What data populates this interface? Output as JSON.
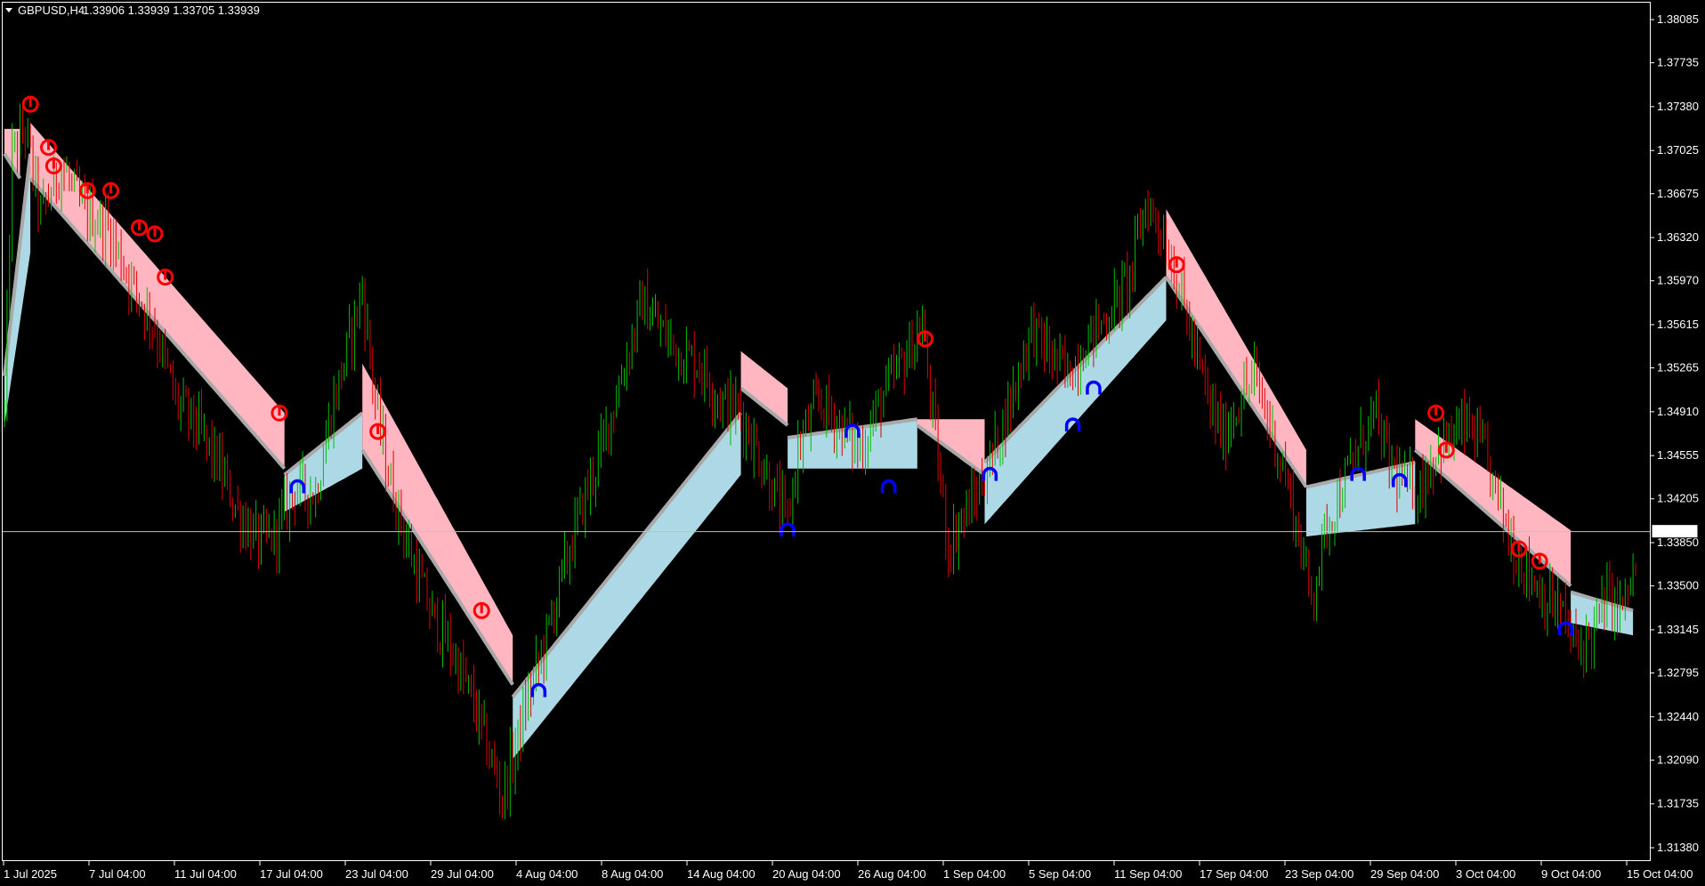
{
  "chart_title": {
    "symbol_label": "GBPUSD,H4",
    "ohlc_text": "1.33906 1.33939 1.33705 1.33939"
  },
  "colors": {
    "background": "#000000",
    "frame": "#ffffff",
    "text": "#ffffff",
    "bull_candle": "#00c000",
    "bear_candle": "#e00000",
    "bear_band": "#ffb6c1",
    "bull_band": "#add8e6",
    "band_edge": "#a9a9a9",
    "sell_arrow": "#ff0000",
    "buy_arrow": "#0000ff",
    "bid_line": "#c0c0c0"
  },
  "icons": {
    "sell_signal": "red-down-arrow-icon",
    "buy_signal": "blue-up-arrow-icon",
    "title_menu": "triangle-down-icon"
  },
  "chart_data": {
    "type": "candlestick",
    "symbol": "GBPUSD",
    "timeframe": "H4",
    "price_axis_ticks": [
      "1.38085",
      "1.37735",
      "1.37380",
      "1.37025",
      "1.36675",
      "1.36320",
      "1.35970",
      "1.35615",
      "1.35265",
      "1.34910",
      "1.34555",
      "1.34205",
      "1.33850",
      "1.33500",
      "1.33145",
      "1.32795",
      "1.32440",
      "1.32090",
      "1.31735",
      "1.31380"
    ],
    "time_axis_ticks": [
      "1 Jul 2025",
      "7 Jul 04:00",
      "11 Jul 04:00",
      "17 Jul 04:00",
      "23 Jul 04:00",
      "29 Jul 04:00",
      "4 Aug 04:00",
      "8 Aug 04:00",
      "14 Aug 04:00",
      "20 Aug 04:00",
      "26 Aug 04:00",
      "1 Sep 04:00",
      "5 Sep 04:00",
      "11 Sep 04:00",
      "17 Sep 04:00",
      "23 Sep 04:00",
      "29 Sep 04:00",
      "3 Oct 04:00",
      "9 Oct 04:00",
      "15 Oct 04:00"
    ],
    "ylim": [
      1.3118,
      1.3826
    ],
    "current_price_label": "1.33939",
    "current_price": 1.33939,
    "price_path": [
      [
        0,
        1.349
      ],
      [
        3,
        1.37
      ],
      [
        8,
        1.372
      ],
      [
        14,
        1.365
      ],
      [
        22,
        1.369
      ],
      [
        30,
        1.3655
      ],
      [
        40,
        1.364
      ],
      [
        48,
        1.36
      ],
      [
        58,
        1.356
      ],
      [
        66,
        1.35
      ],
      [
        74,
        1.348
      ],
      [
        82,
        1.345
      ],
      [
        90,
        1.341
      ],
      [
        98,
        1.3385
      ],
      [
        104,
        1.339
      ],
      [
        112,
        1.343
      ],
      [
        120,
        1.3425
      ],
      [
        126,
        1.349
      ],
      [
        132,
        1.354
      ],
      [
        138,
        1.359
      ],
      [
        143,
        1.35
      ],
      [
        148,
        1.344
      ],
      [
        156,
        1.338
      ],
      [
        164,
        1.333
      ],
      [
        172,
        1.33
      ],
      [
        180,
        1.326
      ],
      [
        186,
        1.322
      ],
      [
        192,
        1.318
      ],
      [
        196,
        1.321
      ],
      [
        202,
        1.326
      ],
      [
        208,
        1.33
      ],
      [
        214,
        1.335
      ],
      [
        222,
        1.341
      ],
      [
        230,
        1.346
      ],
      [
        238,
        1.352
      ],
      [
        246,
        1.358
      ],
      [
        252,
        1.356
      ],
      [
        260,
        1.354
      ],
      [
        268,
        1.353
      ],
      [
        276,
        1.35
      ],
      [
        284,
        1.349
      ],
      [
        290,
        1.346
      ],
      [
        296,
        1.343
      ],
      [
        302,
        1.34
      ],
      [
        306,
        1.346
      ],
      [
        314,
        1.35
      ],
      [
        322,
        1.348
      ],
      [
        330,
        1.346
      ],
      [
        338,
        1.35
      ],
      [
        346,
        1.353
      ],
      [
        354,
        1.356
      ],
      [
        360,
        1.345
      ],
      [
        364,
        1.338
      ],
      [
        368,
        1.34
      ],
      [
        374,
        1.342
      ],
      [
        380,
        1.345
      ],
      [
        388,
        1.35
      ],
      [
        396,
        1.356
      ],
      [
        402,
        1.354
      ],
      [
        410,
        1.352
      ],
      [
        418,
        1.355
      ],
      [
        426,
        1.357
      ],
      [
        434,
        1.36
      ],
      [
        440,
        1.366
      ],
      [
        446,
        1.364
      ],
      [
        452,
        1.36
      ],
      [
        458,
        1.355
      ],
      [
        464,
        1.35
      ],
      [
        470,
        1.347
      ],
      [
        476,
        1.35
      ],
      [
        482,
        1.352
      ],
      [
        488,
        1.348
      ],
      [
        494,
        1.344
      ],
      [
        500,
        1.338
      ],
      [
        504,
        1.334
      ],
      [
        510,
        1.34
      ],
      [
        516,
        1.343
      ],
      [
        522,
        1.346
      ],
      [
        528,
        1.349
      ],
      [
        534,
        1.345
      ],
      [
        540,
        1.343
      ],
      [
        546,
        1.343
      ],
      [
        552,
        1.346
      ],
      [
        558,
        1.347
      ],
      [
        564,
        1.348
      ],
      [
        570,
        1.346
      ],
      [
        576,
        1.342
      ],
      [
        582,
        1.338
      ],
      [
        588,
        1.336
      ],
      [
        594,
        1.334
      ],
      [
        600,
        1.333
      ],
      [
        606,
        1.33
      ],
      [
        612,
        1.331
      ],
      [
        618,
        1.334
      ],
      [
        624,
        1.333
      ],
      [
        628,
        1.336
      ]
    ],
    "bands": [
      {
        "side": "bear",
        "start": 0,
        "end": 6,
        "edge_start": 1.37,
        "edge_end": 1.368,
        "outer_start": 1.372,
        "outer_end": 1.372
      },
      {
        "side": "bull",
        "start": 0,
        "end": 10,
        "edge_start": 1.352,
        "edge_end": 1.37,
        "outer_start": 1.348,
        "outer_end": 1.362
      },
      {
        "side": "bear",
        "start": 10,
        "end": 108,
        "edge_start": 1.368,
        "edge_end": 1.3445,
        "outer_start": 1.3725,
        "outer_end": 1.349
      },
      {
        "side": "bull",
        "start": 108,
        "end": 138,
        "edge_start": 1.344,
        "edge_end": 1.349,
        "outer_start": 1.341,
        "outer_end": 1.3445
      },
      {
        "side": "bear",
        "start": 138,
        "end": 196,
        "edge_start": 1.346,
        "edge_end": 1.327,
        "outer_start": 1.353,
        "outer_end": 1.331
      },
      {
        "side": "bull",
        "start": 196,
        "end": 284,
        "edge_start": 1.326,
        "edge_end": 1.349,
        "outer_start": 1.321,
        "outer_end": 1.344
      },
      {
        "side": "bear",
        "start": 284,
        "end": 302,
        "edge_start": 1.351,
        "edge_end": 1.348,
        "outer_start": 1.354,
        "outer_end": 1.351
      },
      {
        "side": "bull",
        "start": 302,
        "end": 352,
        "edge_start": 1.347,
        "edge_end": 1.3485,
        "outer_start": 1.3445,
        "outer_end": 1.3445
      },
      {
        "side": "bear",
        "start": 352,
        "end": 378,
        "edge_start": 1.348,
        "edge_end": 1.344,
        "outer_start": 1.3485,
        "outer_end": 1.3485
      },
      {
        "side": "bull",
        "start": 378,
        "end": 448,
        "edge_start": 1.345,
        "edge_end": 1.36,
        "outer_start": 1.34,
        "outer_end": 1.3565
      },
      {
        "side": "bear",
        "start": 448,
        "end": 502,
        "edge_start": 1.36,
        "edge_end": 1.343,
        "outer_start": 1.3655,
        "outer_end": 1.346
      },
      {
        "side": "bull",
        "start": 502,
        "end": 544,
        "edge_start": 1.343,
        "edge_end": 1.345,
        "outer_start": 1.339,
        "outer_end": 1.34
      },
      {
        "side": "bear",
        "start": 544,
        "end": 604,
        "edge_start": 1.346,
        "edge_end": 1.335,
        "outer_start": 1.3485,
        "outer_end": 1.3395
      },
      {
        "side": "bull",
        "start": 604,
        "end": 628,
        "edge_start": 1.3345,
        "edge_end": 1.333,
        "outer_start": 1.332,
        "outer_end": 1.331
      }
    ],
    "sell_signals": [
      [
        10,
        1.374
      ],
      [
        17,
        1.3705
      ],
      [
        19,
        1.369
      ],
      [
        32,
        1.367
      ],
      [
        41,
        1.367
      ],
      [
        52,
        1.364
      ],
      [
        58,
        1.3635
      ],
      [
        62,
        1.36
      ],
      [
        106,
        1.349
      ],
      [
        144,
        1.3475
      ],
      [
        184,
        1.333
      ],
      [
        355,
        1.355
      ],
      [
        452,
        1.361
      ],
      [
        552,
        1.349
      ],
      [
        556,
        1.346
      ],
      [
        584,
        1.338
      ],
      [
        592,
        1.337
      ]
    ],
    "buy_signals": [
      [
        113,
        1.343
      ],
      [
        206,
        1.3265
      ],
      [
        302,
        1.3395
      ],
      [
        327,
        1.3475
      ],
      [
        341,
        1.343
      ],
      [
        380,
        1.344
      ],
      [
        412,
        1.348
      ],
      [
        420,
        1.351
      ],
      [
        522,
        1.344
      ],
      [
        538,
        1.3435
      ],
      [
        602,
        1.3315
      ]
    ]
  }
}
